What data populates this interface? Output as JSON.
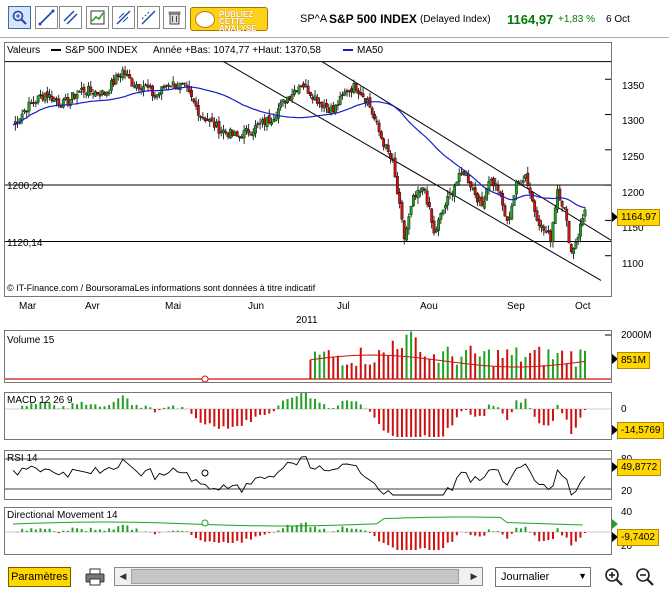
{
  "header": {
    "promo_line1": "PUBLIEZ",
    "promo_line2": "CETTE",
    "promo_line3": "ANALYSE",
    "ticker": "SP^A",
    "name": "S&P 500 INDEX",
    "delay": "(Delayed Index)",
    "price": "1164,97",
    "change": "+1,83 %",
    "date": "6 Oct",
    "price_color": "#007a00"
  },
  "main_panel": {
    "legend_values": "Valeurs",
    "legend_series": "S&P 500 INDEX",
    "legend_range": "Année +Bas: 1074,77 +Haut: 1370,58",
    "legend_ma": "MA50",
    "ma_color": "#1a1acc",
    "level_high_label": "1200,20",
    "level_low_label": "1120,14",
    "footer": "© IT-Finance.com / BoursoramaLes informations sont données à titre indicatif",
    "price_ticks": [
      "1350",
      "1300",
      "1250",
      "1200",
      "1150",
      "1100"
    ],
    "current_value": "1164,97",
    "month_labels": [
      "Mar",
      "Avr",
      "Mai",
      "Jun",
      "Jul",
      "Aou",
      "Sep",
      "Oct"
    ],
    "year": "2011"
  },
  "volume_panel": {
    "title": "Volume 15",
    "tick": "2000M",
    "current_value": "851M"
  },
  "macd_panel": {
    "title": "MACD 12 26 9",
    "tick": "0",
    "current_value": "-14,5769"
  },
  "rsi_panel": {
    "title": "RSI 14",
    "tick_high": "80",
    "tick_low": "20",
    "current_value": "49,8772"
  },
  "dm_panel": {
    "title": "Directional Movement 14",
    "tick_high": "40",
    "tick_low": "20",
    "current_value": "-9,7402"
  },
  "bottom": {
    "params_label": "Paramètres",
    "period_value": "Journalier"
  },
  "colors": {
    "up": "#22a022",
    "down": "#cc1111",
    "value_box": "#ffd600"
  },
  "chart_data": {
    "type": "candlestick",
    "title": "S&P 500 INDEX",
    "ylim": [
      1050,
      1390
    ],
    "series": [
      {
        "name": "S&P 500 INDEX",
        "start": 1290,
        "end": 1164.97
      },
      {
        "name": "MA50"
      }
    ]
  }
}
